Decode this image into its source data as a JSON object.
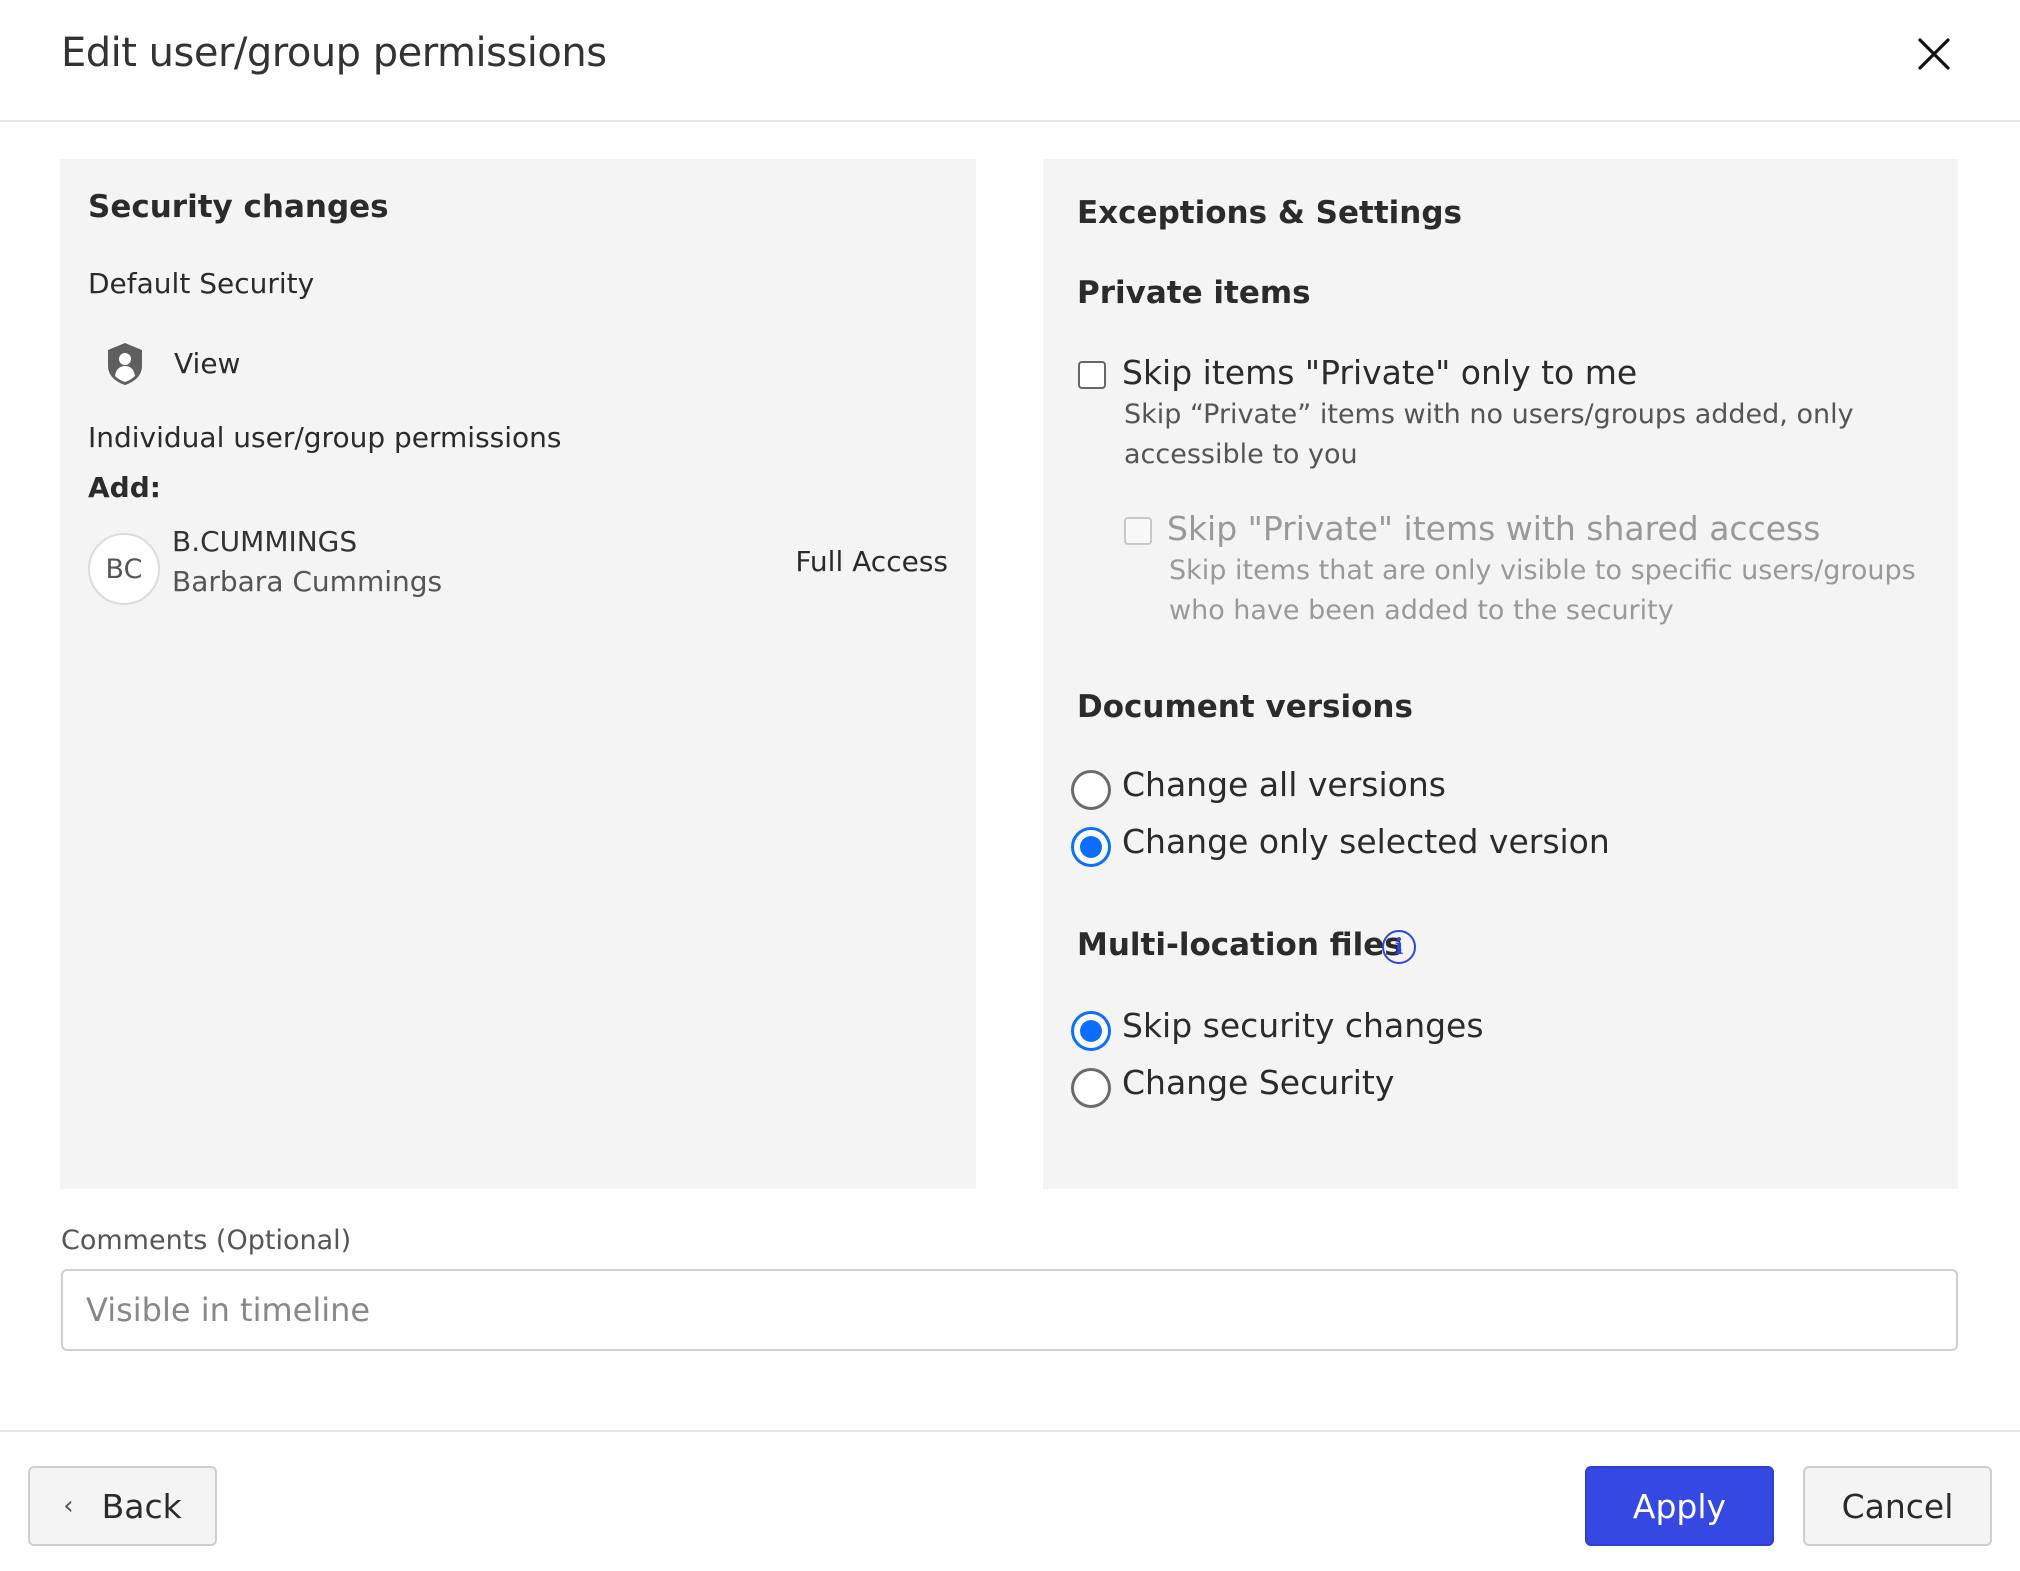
{
  "dialog": {
    "title": "Edit user/group permissions",
    "close_icon": "close-icon"
  },
  "security_changes": {
    "title": "Security changes",
    "default_security_label": "Default Security",
    "default_security_icon": "shield-user-icon",
    "default_security_value": "View",
    "individual_label": "Individual user/group permissions",
    "add_label": "Add:",
    "users": [
      {
        "initials": "BC",
        "username": "B.CUMMINGS",
        "full_name": "Barbara Cummings",
        "permission": "Full Access"
      }
    ]
  },
  "exceptions": {
    "title": "Exceptions & Settings",
    "private_items": {
      "title": "Private items",
      "options": [
        {
          "label": "Skip items \"Private\" only to me",
          "description": "Skip “Private” items with no users/groups added, only accessible to you",
          "checked": false,
          "disabled": false
        },
        {
          "label": "Skip \"Private\" items with shared access",
          "description": "Skip items that are only visible to specific users/groups who have been added to the security",
          "checked": false,
          "disabled": true
        }
      ]
    },
    "document_versions": {
      "title": "Document versions",
      "options": [
        {
          "label": "Change all versions",
          "selected": false
        },
        {
          "label": "Change only selected version",
          "selected": true
        }
      ]
    },
    "multi_location": {
      "title": "Multi-location files",
      "info_icon": "info-icon",
      "options": [
        {
          "label": "Skip security changes",
          "selected": true
        },
        {
          "label": "Change Security",
          "selected": false
        }
      ]
    }
  },
  "comments": {
    "label": "Comments (Optional)",
    "value": "",
    "placeholder": "Visible in timeline"
  },
  "footer": {
    "back_label": "Back",
    "back_icon": "chevron-left-icon",
    "apply_label": "Apply",
    "cancel_label": "Cancel"
  },
  "colors": {
    "accent": "#0d6efd",
    "primary_button": "#3548e2",
    "panel_bg": "#f4f4f4",
    "info": "#2f45e0"
  }
}
